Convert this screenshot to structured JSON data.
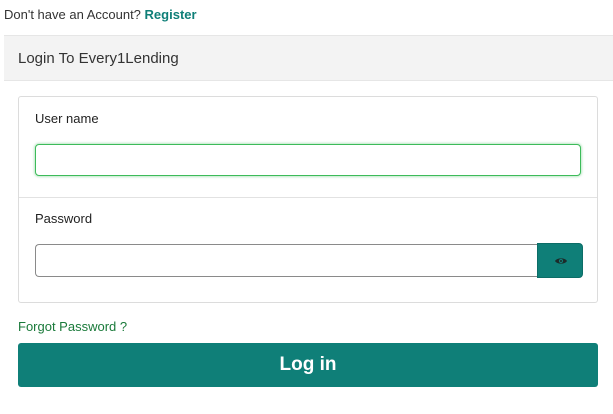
{
  "header_prompt": {
    "text": "Don't have an Account?",
    "register_link": "Register"
  },
  "card": {
    "title": "Login To Every1Lending"
  },
  "form": {
    "username_label": "User name",
    "username_value": "",
    "password_label": "Password",
    "password_value": "",
    "password_toggle_icon": "eye-icon"
  },
  "links": {
    "forgot_password": "Forgot Password ?"
  },
  "actions": {
    "login_label": "Log in"
  },
  "colors": {
    "primary": "#0f7f78",
    "focus_border": "#3dbb5a",
    "link_green": "#1a7a3a"
  }
}
